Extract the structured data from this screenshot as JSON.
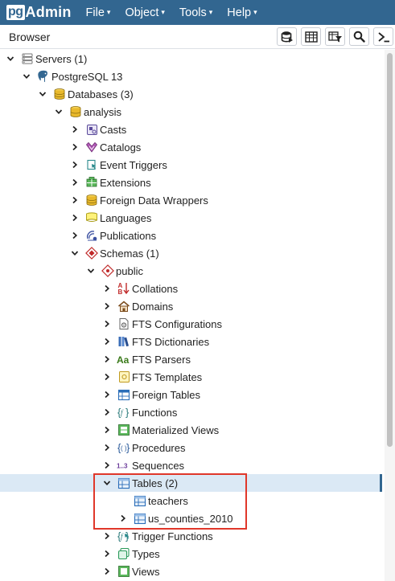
{
  "app": {
    "logo_pg": "pg",
    "logo_admin": "Admin",
    "accent_color": "#326690"
  },
  "menu": {
    "items": [
      {
        "label": "File",
        "caret": "▾"
      },
      {
        "label": "Object",
        "caret": "▾"
      },
      {
        "label": "Tools",
        "caret": "▾"
      },
      {
        "label": "Help",
        "caret": "▾"
      }
    ]
  },
  "browser": {
    "title": "Browser",
    "toolbar": [
      {
        "name": "query-tool-icon"
      },
      {
        "name": "view-data-icon"
      },
      {
        "name": "filtered-rows-icon"
      },
      {
        "name": "search-objects-icon"
      },
      {
        "name": "psql-tool-icon"
      }
    ]
  },
  "tree": [
    {
      "label": "Servers (1)",
      "depth": 0,
      "state": "expanded",
      "icon": "servers-icon"
    },
    {
      "label": "PostgreSQL 13",
      "depth": 1,
      "state": "expanded",
      "icon": "postgresql-elephant-icon"
    },
    {
      "label": "Databases (3)",
      "depth": 2,
      "state": "expanded",
      "icon": "databases-icon"
    },
    {
      "label": "analysis",
      "depth": 3,
      "state": "expanded",
      "icon": "database-icon"
    },
    {
      "label": "Casts",
      "depth": 4,
      "state": "collapsed",
      "icon": "casts-icon"
    },
    {
      "label": "Catalogs",
      "depth": 4,
      "state": "collapsed",
      "icon": "catalogs-icon"
    },
    {
      "label": "Event Triggers",
      "depth": 4,
      "state": "collapsed",
      "icon": "event-triggers-icon"
    },
    {
      "label": "Extensions",
      "depth": 4,
      "state": "collapsed",
      "icon": "extensions-icon"
    },
    {
      "label": "Foreign Data Wrappers",
      "depth": 4,
      "state": "collapsed",
      "icon": "foreign-data-wrappers-icon"
    },
    {
      "label": "Languages",
      "depth": 4,
      "state": "collapsed",
      "icon": "languages-icon"
    },
    {
      "label": "Publications",
      "depth": 4,
      "state": "collapsed",
      "icon": "publications-icon"
    },
    {
      "label": "Schemas (1)",
      "depth": 4,
      "state": "expanded",
      "icon": "schemas-icon"
    },
    {
      "label": "public",
      "depth": 5,
      "state": "expanded",
      "icon": "schema-icon"
    },
    {
      "label": "Collations",
      "depth": 6,
      "state": "collapsed",
      "icon": "collations-icon"
    },
    {
      "label": "Domains",
      "depth": 6,
      "state": "collapsed",
      "icon": "domains-icon"
    },
    {
      "label": "FTS Configurations",
      "depth": 6,
      "state": "collapsed",
      "icon": "fts-configurations-icon"
    },
    {
      "label": "FTS Dictionaries",
      "depth": 6,
      "state": "collapsed",
      "icon": "fts-dictionaries-icon"
    },
    {
      "label": "FTS Parsers",
      "depth": 6,
      "state": "collapsed",
      "icon": "fts-parsers-icon"
    },
    {
      "label": "FTS Templates",
      "depth": 6,
      "state": "collapsed",
      "icon": "fts-templates-icon"
    },
    {
      "label": "Foreign Tables",
      "depth": 6,
      "state": "collapsed",
      "icon": "foreign-tables-icon"
    },
    {
      "label": "Functions",
      "depth": 6,
      "state": "collapsed",
      "icon": "functions-icon"
    },
    {
      "label": "Materialized Views",
      "depth": 6,
      "state": "collapsed",
      "icon": "materialized-views-icon"
    },
    {
      "label": "Procedures",
      "depth": 6,
      "state": "collapsed",
      "icon": "procedures-icon"
    },
    {
      "label": "Sequences",
      "depth": 6,
      "state": "collapsed",
      "icon": "sequences-icon"
    },
    {
      "label": "Tables (2)",
      "depth": 6,
      "state": "expanded",
      "icon": "tables-icon",
      "selected": true
    },
    {
      "label": "teachers",
      "depth": 7,
      "state": "leaf",
      "icon": "table-icon"
    },
    {
      "label": "us_counties_2010",
      "depth": 7,
      "state": "collapsed",
      "icon": "table-icon"
    },
    {
      "label": "Trigger Functions",
      "depth": 6,
      "state": "collapsed",
      "icon": "trigger-functions-icon"
    },
    {
      "label": "Types",
      "depth": 6,
      "state": "collapsed",
      "icon": "types-icon"
    },
    {
      "label": "Views",
      "depth": 6,
      "state": "collapsed",
      "icon": "views-icon"
    }
  ]
}
